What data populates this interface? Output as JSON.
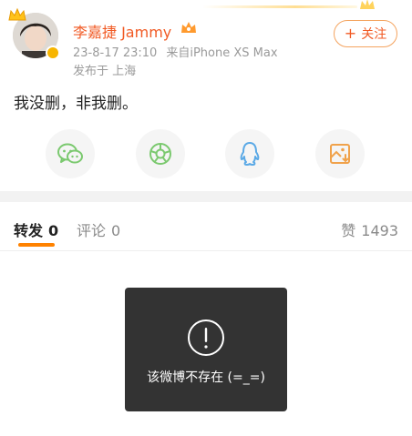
{
  "post": {
    "username": "李嘉捷 Jammy",
    "date": "23-8-17 23:10",
    "device": "来自iPhone XS Max",
    "location": "发布于 上海",
    "follow_plus": "+",
    "follow_label": "关注",
    "text": "我没删，非我删。"
  },
  "share": {
    "icons": [
      "wechat-icon",
      "moments-icon",
      "qq-icon",
      "save-image-icon"
    ]
  },
  "tabs": {
    "repost_label": "转发",
    "repost_count": "0",
    "comment_label": "评论",
    "comment_count": "0",
    "like_label": "赞",
    "like_count": "1493"
  },
  "toast": {
    "icon": "exclamation-circle-icon",
    "message": "该微博不存在 (=_=)"
  },
  "colors": {
    "accent": "#ff8200",
    "username": "#f15a24",
    "share_green": "#7bc96f",
    "share_blue": "#5aa9e6",
    "share_orange": "#f0a24b"
  }
}
